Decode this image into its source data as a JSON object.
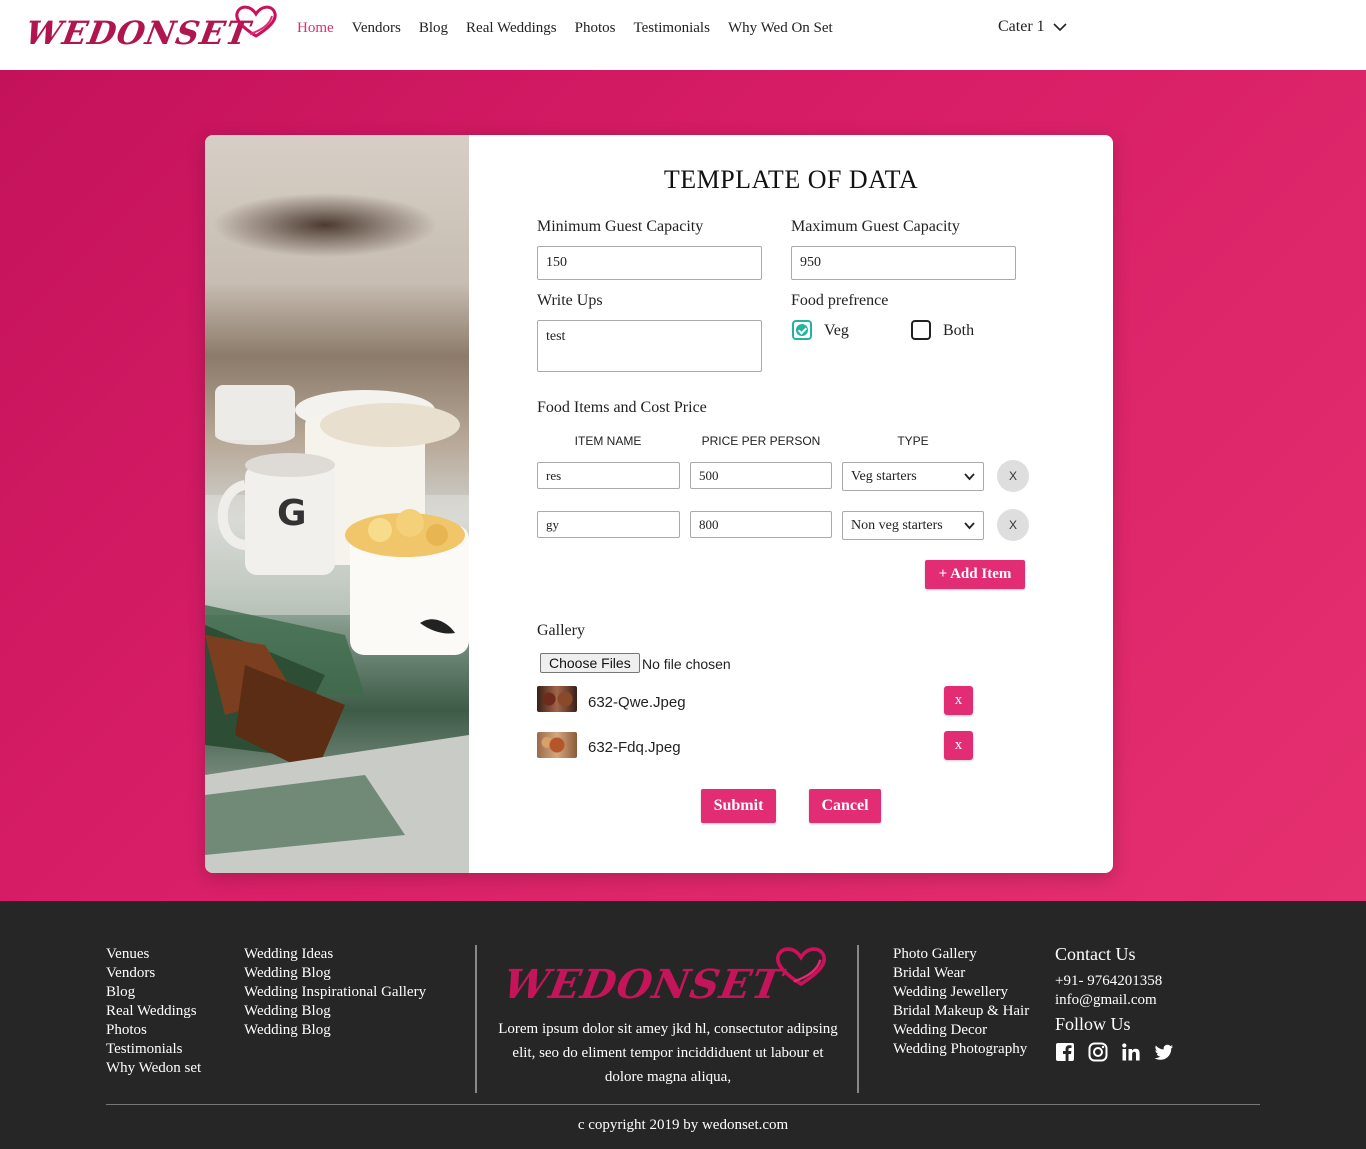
{
  "brand": {
    "logo_text": "WEDONSET",
    "accent": "#e22d74"
  },
  "nav": {
    "items": [
      "Home",
      "Vendors",
      "Blog",
      "Real Weddings",
      "Photos",
      "Testimonials",
      "Why Wed On Set"
    ],
    "active": "Home"
  },
  "user_menu": {
    "label": "Cater 1"
  },
  "form": {
    "title": "TEMPLATE OF DATA",
    "min_guest_label": "Minimum Guest Capacity",
    "min_guest_value": "150",
    "max_guest_label": "Maximum Guest Capacity",
    "max_guest_value": "950",
    "writeups_label": "Write Ups",
    "writeups_value": "test",
    "food_pref_label": "Food prefrence",
    "food_pref_options": [
      {
        "label": "Veg",
        "checked": true
      },
      {
        "label": "Both",
        "checked": false
      }
    ],
    "food_items_label": "Food Items and Cost Price",
    "columns": [
      "ITEM NAME",
      "PRICE PER PERSON",
      "TYPE"
    ],
    "rows": [
      {
        "name": "res",
        "price": "500",
        "type": "Veg starters",
        "remove": "X"
      },
      {
        "name": "gy",
        "price": "800",
        "type": "Non veg starters",
        "remove": "X"
      }
    ],
    "add_item_label": "+ Add Item",
    "gallery_label": "Gallery",
    "choose_files_label": "Choose Files",
    "file_status": "No file chosen",
    "files": [
      {
        "name": "632-Qwe.Jpeg",
        "remove": "x"
      },
      {
        "name": "632-Fdq.Jpeg",
        "remove": "x"
      }
    ],
    "submit_label": "Submit",
    "cancel_label": "Cancel"
  },
  "footer": {
    "col1": [
      "Venues",
      "Vendors",
      "Blog",
      "Real Weddings",
      "Photos",
      "Testimonials",
      "Why Wedon set"
    ],
    "col2": [
      "Wedding Ideas",
      "Wedding Blog",
      "Wedding Inspirational Gallery",
      "Wedding Blog",
      "Wedding Blog"
    ],
    "logo_text": "WEDONSET",
    "tagline": "Lorem ipsum dolor sit amey jkd hl, consectutor adipsing elit, seo do eliment tempor inciddiduent ut labour et dolore magna aliqua,",
    "col3": [
      "Photo Gallery",
      "Bridal Wear",
      "Wedding Jewellery",
      "Bridal Makeup & Hair",
      "Wedding Decor",
      "Wedding Photography"
    ],
    "contact_heading": "Contact Us",
    "phone": "+91- 9764201358",
    "email": "info@gmail.com",
    "follow_heading": "Follow Us",
    "social_icons": [
      "facebook-icon",
      "instagram-icon",
      "linkedin-icon",
      "twitter-icon"
    ],
    "copyright": "c copyright 2019 by wedonset.com"
  }
}
